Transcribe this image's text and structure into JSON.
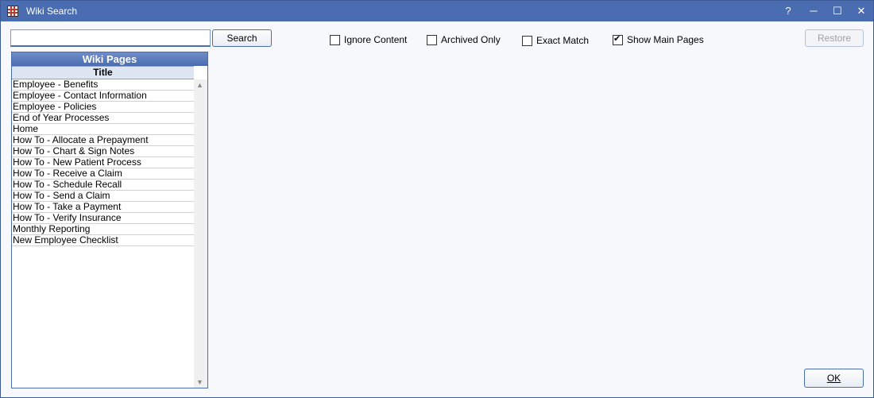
{
  "window": {
    "title": "Wiki Search",
    "controls": {
      "help": "?",
      "minimize": "─",
      "maximize": "☐",
      "close": "✕"
    }
  },
  "search": {
    "value": "",
    "button_label": "Search"
  },
  "options": [
    {
      "label": "Ignore Content",
      "checked": false
    },
    {
      "label": "Archived Only",
      "checked": false
    },
    {
      "label": "Exact Match",
      "checked": false
    },
    {
      "label": "Show Main Pages",
      "checked": true
    }
  ],
  "restore_label": "Restore",
  "grid": {
    "title": "Wiki Pages",
    "column": "Title",
    "rows": [
      "Employee - Benefits",
      "Employee - Contact Information",
      "Employee - Policies",
      "End of Year Processes",
      "Home",
      "How To - Allocate a Prepayment",
      "How To - Chart & Sign Notes",
      "How To - New Patient Process",
      "How To - Receive a Claim",
      "How To - Schedule Recall",
      "How To - Send a Claim",
      "How To - Take a Payment",
      "How To - Verify Insurance",
      "Monthly Reporting",
      "New Employee Checklist"
    ]
  },
  "ok_label": "OK",
  "check_mark": "✔"
}
